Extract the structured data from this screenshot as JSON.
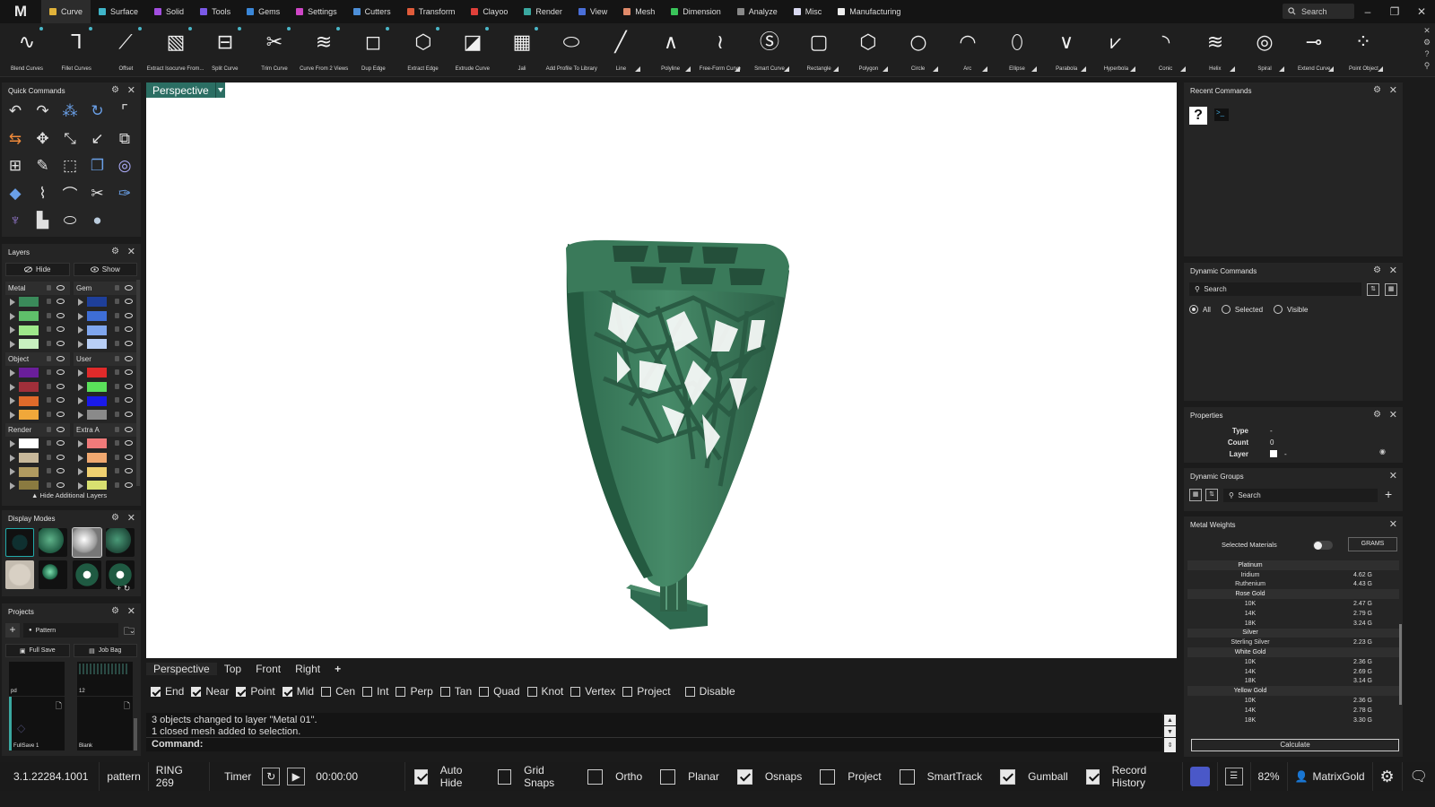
{
  "app": {
    "logo": "M"
  },
  "menu": {
    "tabs": [
      {
        "label": "Curve",
        "color": "#e0b23a"
      },
      {
        "label": "Surface",
        "color": "#3fb5c9"
      },
      {
        "label": "Solid",
        "color": "#a24ee0"
      },
      {
        "label": "Tools",
        "color": "#7a59e6"
      },
      {
        "label": "Gems",
        "color": "#3a87d9"
      },
      {
        "label": "Settings",
        "color": "#cf46c7"
      },
      {
        "label": "Cutters",
        "color": "#4d8fd8"
      },
      {
        "label": "Transform",
        "color": "#e05b3a"
      },
      {
        "label": "Clayoo",
        "color": "#e0403a"
      },
      {
        "label": "Render",
        "color": "#3aa8a0"
      },
      {
        "label": "View",
        "color": "#4a6fd9"
      },
      {
        "label": "Mesh",
        "color": "#e08a6a"
      },
      {
        "label": "Dimension",
        "color": "#3ac45a"
      },
      {
        "label": "Analyze",
        "color": "#888888"
      },
      {
        "label": "Misc",
        "color": "#d9d9f0"
      },
      {
        "label": "Manufacturing",
        "color": "#eeeeee"
      }
    ],
    "search_label": "Search",
    "window_controls": {
      "minimize": "–",
      "restore": "❐",
      "close": "✕"
    }
  },
  "toolbar": {
    "tools": [
      {
        "label": "Blend Curves",
        "icon": "blend-curves-icon"
      },
      {
        "label": "Fillet Curves",
        "icon": "fillet-curves-icon"
      },
      {
        "label": "Offset",
        "icon": "offset-icon"
      },
      {
        "label": "Extract Isocurve From...",
        "icon": "extract-isocurve-icon"
      },
      {
        "label": "Split Curve",
        "icon": "split-curve-icon"
      },
      {
        "label": "Trim Curve",
        "icon": "trim-curve-icon"
      },
      {
        "label": "Curve From 2 Views",
        "icon": "curve-from-2-views-icon"
      },
      {
        "label": "Dup Edge",
        "icon": "dup-edge-icon"
      },
      {
        "label": "Extract Edge",
        "icon": "extract-edge-icon"
      },
      {
        "label": "Extrude Curve",
        "icon": "extrude-curve-icon"
      },
      {
        "label": "Jali",
        "icon": "jali-icon"
      },
      {
        "label": "Add Profile To Library",
        "icon": "add-profile-icon"
      },
      {
        "label": "Line",
        "icon": "line-icon"
      },
      {
        "label": "Polyline",
        "icon": "polyline-icon"
      },
      {
        "label": "Free-Form Curve",
        "icon": "free-form-curve-icon"
      },
      {
        "label": "Smart Curve",
        "icon": "smart-curve-icon"
      },
      {
        "label": "Rectangle",
        "icon": "rectangle-icon"
      },
      {
        "label": "Polygon",
        "icon": "polygon-icon"
      },
      {
        "label": "Circle",
        "icon": "circle-icon"
      },
      {
        "label": "Arc",
        "icon": "arc-icon"
      },
      {
        "label": "Ellipse",
        "icon": "ellipse-icon"
      },
      {
        "label": "Parabola",
        "icon": "parabola-icon"
      },
      {
        "label": "Hyperbola",
        "icon": "hyperbola-icon"
      },
      {
        "label": "Conic",
        "icon": "conic-icon"
      },
      {
        "label": "Helix",
        "icon": "helix-icon"
      },
      {
        "label": "Spiral",
        "icon": "spiral-icon"
      },
      {
        "label": "Extend Curve",
        "icon": "extend-curve-icon"
      },
      {
        "label": "Point Object",
        "icon": "point-object-icon"
      }
    ]
  },
  "quick_commands": {
    "title": "Quick Commands"
  },
  "layers": {
    "title": "Layers",
    "hide_label": "Hide",
    "show_label": "Show",
    "hide_additional_label": "Hide Additional Layers",
    "groups": [
      {
        "name": "Metal",
        "colors": [
          "#3a8a5a",
          "#5fbf6a",
          "#9ee88a",
          "#c8f0c0"
        ]
      },
      {
        "name": "Gem",
        "colors": [
          "#1e3f9a",
          "#3e6ed6",
          "#7fa6ee",
          "#b8cff6"
        ]
      },
      {
        "name": "Object",
        "colors": [
          "#6a1e9a",
          "#a02f3a",
          "#e06a2a",
          "#f0a83a"
        ]
      },
      {
        "name": "User",
        "colors": [
          "#e02a2a",
          "#5ae05a",
          "#1a1ae8",
          "#8a8a8a"
        ]
      },
      {
        "name": "Render",
        "colors": [
          "#ffffff",
          "#c8b89a",
          "#b09a60",
          "#8a7a40"
        ]
      },
      {
        "name": "Extra A",
        "colors": [
          "#f07a7a",
          "#f0a870",
          "#f0d070",
          "#d8e070"
        ]
      }
    ]
  },
  "display_modes": {
    "title": "Display Modes"
  },
  "projects": {
    "title": "Projects",
    "selected": "Pattern",
    "full_save_label": "Full Save",
    "job_bag_label": "Job Bag",
    "thumbs": [
      {
        "label": "pd"
      },
      {
        "label": "12"
      },
      {
        "label": "FullSave 1"
      },
      {
        "label": "Blank"
      }
    ]
  },
  "viewport": {
    "active_label": "Perspective",
    "tabs": [
      "Perspective",
      "Top",
      "Front",
      "Right"
    ],
    "add_tab_label": "+",
    "model_color": "#3d7a5e"
  },
  "snaps": [
    {
      "label": "End",
      "checked": true
    },
    {
      "label": "Near",
      "checked": true
    },
    {
      "label": "Point",
      "checked": true
    },
    {
      "label": "Mid",
      "checked": true
    },
    {
      "label": "Cen",
      "checked": false
    },
    {
      "label": "Int",
      "checked": false
    },
    {
      "label": "Perp",
      "checked": false
    },
    {
      "label": "Tan",
      "checked": false
    },
    {
      "label": "Quad",
      "checked": false
    },
    {
      "label": "Knot",
      "checked": false
    },
    {
      "label": "Vertex",
      "checked": false
    },
    {
      "label": "Project",
      "checked": false
    },
    {
      "label": "Disable",
      "checked": false
    }
  ],
  "command": {
    "history": [
      "3 objects changed to layer \"Metal 01\".",
      "1 closed mesh added to selection."
    ],
    "prompt": "Command:"
  },
  "status": {
    "version": "3.1.22284.1001",
    "project": "pattern",
    "file": "RING 269",
    "timer_label": "Timer",
    "timer_value": "00:00:00",
    "toggles": [
      {
        "label": "Auto Hide",
        "checked": true
      },
      {
        "label": "Grid Snaps",
        "checked": false
      },
      {
        "label": "Ortho",
        "checked": false
      },
      {
        "label": "Planar",
        "checked": false
      },
      {
        "label": "Osnaps",
        "checked": true
      },
      {
        "label": "Project",
        "checked": false
      },
      {
        "label": "SmartTrack",
        "checked": false
      },
      {
        "label": "Gumball",
        "checked": true
      },
      {
        "label": "Record History",
        "checked": true
      }
    ],
    "zoom": "82%",
    "user": "MatrixGold"
  },
  "recent_commands": {
    "title": "Recent Commands"
  },
  "dynamic_commands": {
    "title": "Dynamic Commands",
    "search_label": "Search",
    "filters": [
      {
        "label": "All",
        "selected": true
      },
      {
        "label": "Selected",
        "selected": false
      },
      {
        "label": "Visible",
        "selected": false
      }
    ]
  },
  "properties": {
    "title": "Properties",
    "type_label": "Type",
    "type_value": "-",
    "count_label": "Count",
    "count_value": "0",
    "layer_label": "Layer",
    "layer_value": "-"
  },
  "dynamic_groups": {
    "title": "Dynamic Groups",
    "search_label": "Search",
    "add_label": "+"
  },
  "metal_weights": {
    "title": "Metal Weights",
    "selected_materials_label": "Selected Materials",
    "unit_label": "GRAMS",
    "calculate_label": "Calculate",
    "rows": [
      {
        "name": "Platinum",
        "value": "",
        "group": true
      },
      {
        "name": "Iridium",
        "value": "4.62 G",
        "group": false
      },
      {
        "name": "Ruthenium",
        "value": "4.43 G",
        "group": false
      },
      {
        "name": "Rose Gold",
        "value": "",
        "group": true
      },
      {
        "name": "10K",
        "value": "2.47 G",
        "group": false
      },
      {
        "name": "14K",
        "value": "2.79 G",
        "group": false
      },
      {
        "name": "18K",
        "value": "3.24 G",
        "group": false
      },
      {
        "name": "Silver",
        "value": "",
        "group": true
      },
      {
        "name": "Sterling Silver",
        "value": "2.23 G",
        "group": false
      },
      {
        "name": "White Gold",
        "value": "",
        "group": true
      },
      {
        "name": "10K",
        "value": "2.36 G",
        "group": false
      },
      {
        "name": "14K",
        "value": "2.69 G",
        "group": false
      },
      {
        "name": "18K",
        "value": "3.14 G",
        "group": false
      },
      {
        "name": "Yellow Gold",
        "value": "",
        "group": true
      },
      {
        "name": "10K",
        "value": "2.36 G",
        "group": false
      },
      {
        "name": "14K",
        "value": "2.78 G",
        "group": false
      },
      {
        "name": "18K",
        "value": "3.30 G",
        "group": false
      }
    ]
  }
}
